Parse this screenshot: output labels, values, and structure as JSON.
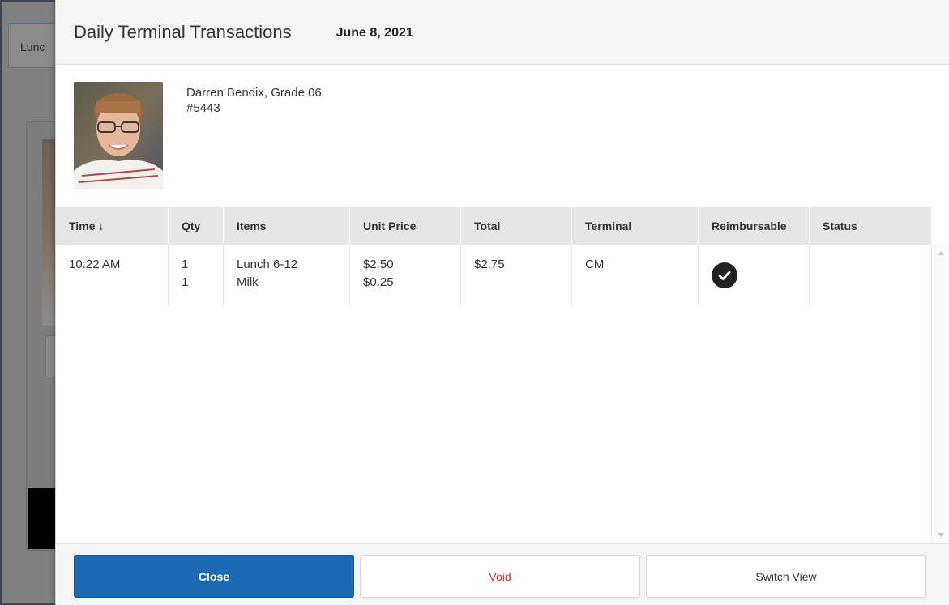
{
  "background": {
    "tab_label": "Lunc"
  },
  "modal": {
    "title": "Daily Terminal Transactions",
    "date": "June 8, 2021"
  },
  "student": {
    "name_grade": "Darren Bendix, Grade 06",
    "id": "#5443"
  },
  "table": {
    "columns": [
      "Time ↓",
      "Qty",
      "Items",
      "Unit Price",
      "Total",
      "Terminal",
      "Reimbursable",
      "Status"
    ],
    "sort_icon": "arrow-down-icon",
    "rows": [
      {
        "time": "10:22 AM",
        "qty": [
          "1",
          "1"
        ],
        "items": [
          "Lunch 6-12",
          "Milk"
        ],
        "unit_price": [
          "$2.50",
          "$0.25"
        ],
        "total": "$2.75",
        "terminal": "CM",
        "reimbursable_icon": "check-circle-icon",
        "status": ""
      }
    ]
  },
  "buttons": {
    "close": "Close",
    "void": "Void",
    "switch_view": "Switch View"
  },
  "colors": {
    "primary": "#1b6ab3",
    "void": "#d0302f",
    "header_bg": "#f5f5f5",
    "table_header_bg": "#e6e6e6"
  }
}
